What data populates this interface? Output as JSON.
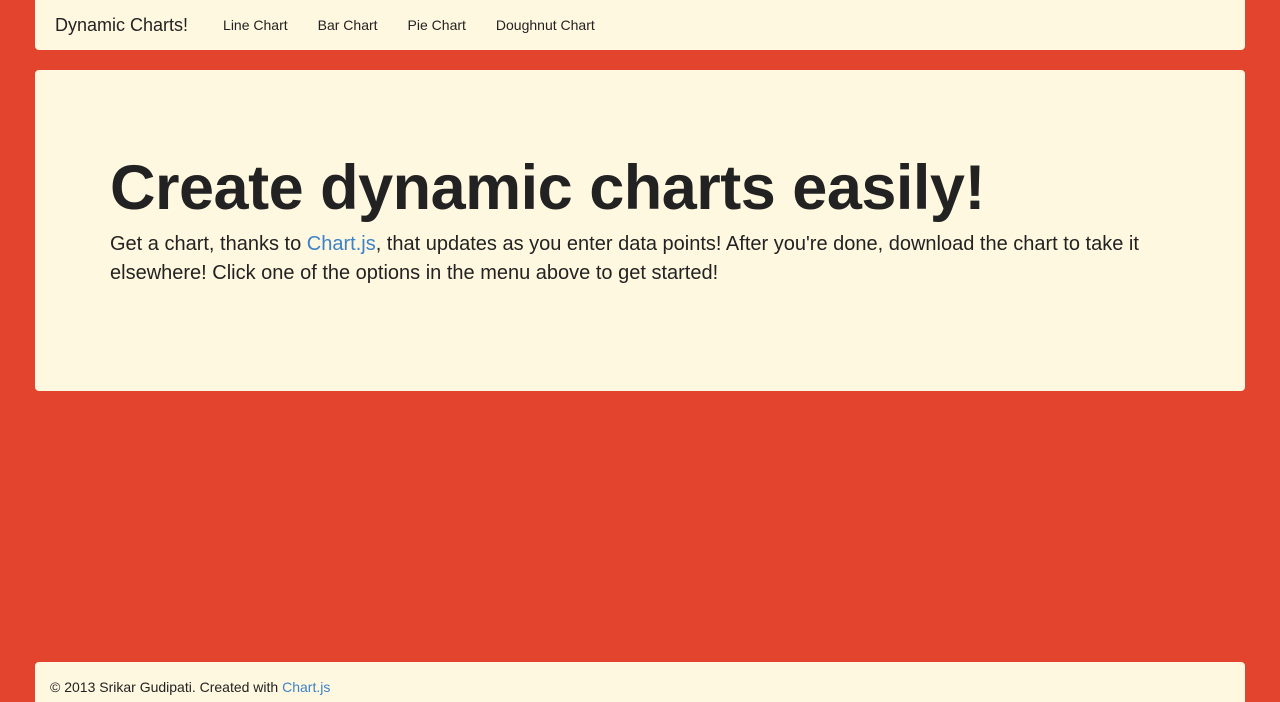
{
  "navbar": {
    "brand": "Dynamic Charts!",
    "links": [
      {
        "label": "Line Chart"
      },
      {
        "label": "Bar Chart"
      },
      {
        "label": "Pie Chart"
      },
      {
        "label": "Doughnut Chart"
      }
    ]
  },
  "hero": {
    "title": "Create dynamic charts easily!",
    "text_before_link": "Get a chart, thanks to ",
    "link_label": "Chart.js",
    "text_after_link": ", that updates as you enter data points! After you're done, download the chart to take it elsewhere! Click one of the options in the menu above to get started!"
  },
  "footer": {
    "text": "© 2013 Srikar Gudipati. Created with ",
    "link_label": "Chart.js"
  },
  "colors": {
    "background": "#e2442d",
    "panel": "#fff8e0",
    "link": "#3d82c8",
    "text": "#222222"
  }
}
